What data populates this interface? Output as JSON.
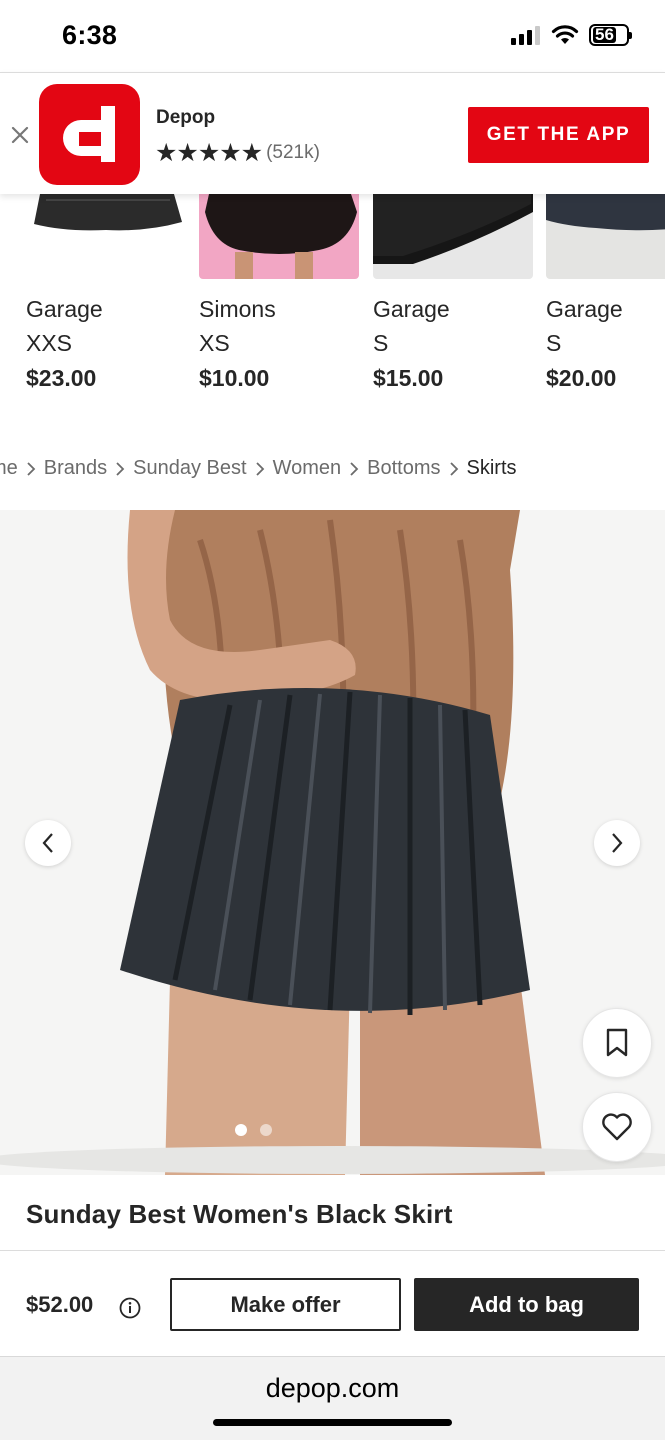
{
  "status_bar": {
    "time": "6:38",
    "battery": "56"
  },
  "app_banner": {
    "app_name": "Depop",
    "stars": "★★★★★",
    "rating_count": "(521k)",
    "cta": "GET THE APP",
    "brand_color": "#e30613"
  },
  "similar_items": [
    {
      "brand": "Garage",
      "size": "XXS",
      "price": "$23.00"
    },
    {
      "brand": "Simons",
      "size": "XS",
      "price": "$10.00"
    },
    {
      "brand": "Garage",
      "size": "S",
      "price": "$15.00"
    },
    {
      "brand": "Garage",
      "size": "S",
      "price": "$20.00"
    }
  ],
  "breadcrumb": {
    "items": [
      "me",
      "Brands",
      "Sunday Best",
      "Women",
      "Bottoms",
      "Skirts"
    ]
  },
  "product": {
    "title": "Sunday Best Women's Black Skirt",
    "price": "$52.00",
    "image_count": 2,
    "active_image": 1
  },
  "actions": {
    "make_offer": "Make offer",
    "add_to_bag": "Add to bag"
  },
  "browser": {
    "url": "depop.com"
  }
}
